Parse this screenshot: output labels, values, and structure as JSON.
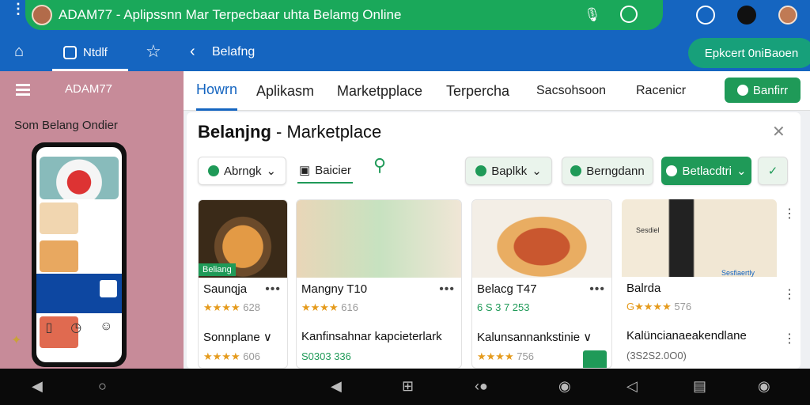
{
  "app": {
    "window_title": "ADAM77 - Aplipssnn Mar Terpecbaar uhta Belamg Online",
    "primary_color": "#1565c0",
    "accent_color": "#1aa85a"
  },
  "navbar": {
    "tab_label": "Ntdlf",
    "breadcrumb": "Belafng",
    "cta_label": "Epkcert 0niBaoen"
  },
  "left_panel": {
    "username": "ADAM77",
    "caption": "Som Belang Ondier"
  },
  "tabs": [
    {
      "label": "Howrn",
      "active": true
    },
    {
      "label": "Aplikasm",
      "active": false
    },
    {
      "label": "Marketpplace",
      "active": false
    },
    {
      "label": "Terpercha",
      "active": false
    },
    {
      "label": "Sacsohsoon",
      "active": false
    },
    {
      "label": "Racenicr",
      "active": false
    }
  ],
  "tab_button": "Banfirr",
  "card": {
    "title_bold": "Belanjng",
    "title_rest": " - Marketplace"
  },
  "filters": {
    "chip1": "Abrngk",
    "tab": "Baicier",
    "chip2": "Baplkk",
    "chip3": "Berngdann",
    "chip4": "Betlacdtri"
  },
  "products": [
    {
      "label": "Beliang",
      "name": "Saunqja",
      "rating": "★★★★",
      "rating_num": "628",
      "sub": "Sonnplane ∨",
      "rating2": "★★★★",
      "rating2_num": "606"
    },
    {
      "label": "",
      "name": "Mangny T10",
      "rating": "★★★★",
      "rating_num": "616",
      "sub": "Kanfinsahnar kapcieterlark",
      "rating2": "S0303 336",
      "rating2_num": ""
    },
    {
      "label": "",
      "name": "Belacg T47",
      "rating": "6 S 3 7 253",
      "rating_num": "",
      "sub": "Kalunsannankstinie ∨",
      "rating2": "★★★★",
      "rating2_num": "756"
    },
    {
      "label": "Sesdiel",
      "name": "Balrda",
      "rating": "G★★★★",
      "rating_num": "576",
      "sub": "Kalüncianaeakendlane",
      "rating2": "(3S2S2.0O0)",
      "rating2_num": ""
    }
  ],
  "product4_side": "Sesfiaertly"
}
